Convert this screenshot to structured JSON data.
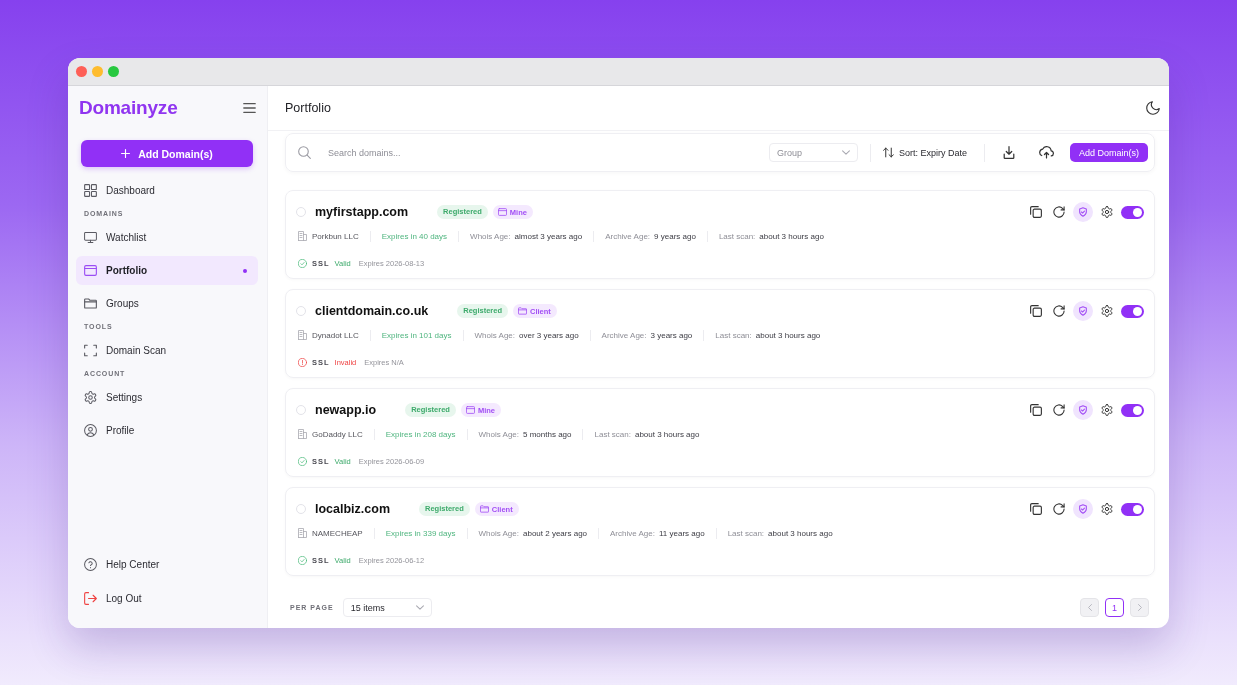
{
  "sidebar": {
    "logo": "Domainyze",
    "add_button": {
      "label": "Add Domain(s)"
    },
    "sections": [
      {
        "items": [
          {
            "label": "Dashboard",
            "selected": false
          }
        ]
      },
      {
        "heading": "DOMAINS",
        "items": [
          {
            "label": "Watchlist",
            "selected": false
          },
          {
            "label": "Portfolio",
            "selected": true
          },
          {
            "label": "Groups",
            "selected": false
          }
        ]
      },
      {
        "heading": "TOOLS",
        "items": [
          {
            "label": "Domain Scan",
            "selected": false
          }
        ]
      },
      {
        "heading": "ACCOUNT",
        "items": [
          {
            "label": "Settings",
            "selected": false
          },
          {
            "label": "Profile",
            "selected": false
          }
        ]
      }
    ],
    "footer_items": [
      {
        "label": "Help Center"
      },
      {
        "label": "Log Out"
      }
    ]
  },
  "header": {
    "title": "Portfolio"
  },
  "toolbar": {
    "search": {
      "placeholder": "Search domains..."
    },
    "group_select": {
      "placeholder": "Group"
    },
    "sort": {
      "label": "Sort: Expiry Date"
    },
    "add_button": {
      "label": "Add Domain(s)"
    }
  },
  "domains": [
    {
      "name": "myfirstapp.com",
      "checked": false,
      "status": "Registered",
      "tag": {
        "label": "Mine",
        "kind": "window"
      },
      "registrar": "Porkbun LLC",
      "expiry": "Expires in 40 days",
      "facts": [
        {
          "label": "Whois Age:",
          "value": "almost 3 years ago"
        },
        {
          "label": "Archive Age:",
          "value": "9 years ago"
        },
        {
          "label": "Last scan:",
          "value": "about 3 hours ago"
        }
      ],
      "ssl": {
        "label": "SSL",
        "valid": true,
        "status": "Valid",
        "expires": "Expires 2026-08-13"
      },
      "on": true
    },
    {
      "name": "clientdomain.co.uk",
      "checked": false,
      "status": "Registered",
      "tag": {
        "label": "Client",
        "kind": "folder"
      },
      "registrar": "Dynadot LLC",
      "expiry": "Expires in 101 days",
      "facts": [
        {
          "label": "Whois Age:",
          "value": "over 3 years ago"
        },
        {
          "label": "Archive Age:",
          "value": "3 years ago"
        },
        {
          "label": "Last scan:",
          "value": "about 3 hours ago"
        }
      ],
      "ssl": {
        "label": "SSL",
        "valid": false,
        "status": "Invalid",
        "expires": "Expires N/A"
      },
      "on": true
    },
    {
      "name": "newapp.io",
      "checked": false,
      "status": "Registered",
      "tag": {
        "label": "Mine",
        "kind": "window"
      },
      "registrar": "GoDaddy LLC",
      "expiry": "Expires in 208 days",
      "facts": [
        {
          "label": "Whois Age:",
          "value": "5 months ago"
        },
        {
          "label": "Last scan:",
          "value": "about 3 hours ago"
        }
      ],
      "ssl": {
        "label": "SSL",
        "valid": true,
        "status": "Valid",
        "expires": "Expires 2026-06-09"
      },
      "on": true
    },
    {
      "name": "localbiz.com",
      "checked": false,
      "status": "Registered",
      "tag": {
        "label": "Client",
        "kind": "folder"
      },
      "registrar": "NAMECHEAP",
      "expiry": "Expires in 339 days",
      "facts": [
        {
          "label": "Whois Age:",
          "value": "about 2 years ago"
        },
        {
          "label": "Archive Age:",
          "value": "11 years ago"
        },
        {
          "label": "Last scan:",
          "value": "about 3 hours ago"
        }
      ],
      "ssl": {
        "label": "SSL",
        "valid": true,
        "status": "Valid",
        "expires": "Expires 2026-06-12"
      },
      "on": true
    }
  ],
  "pagination": {
    "per_page_label": "PER PAGE",
    "per_page": "15 items",
    "prev": {
      "disabled": true
    },
    "pages": [
      {
        "label": "1",
        "selected": true
      }
    ],
    "next": {
      "disabled": true
    }
  }
}
